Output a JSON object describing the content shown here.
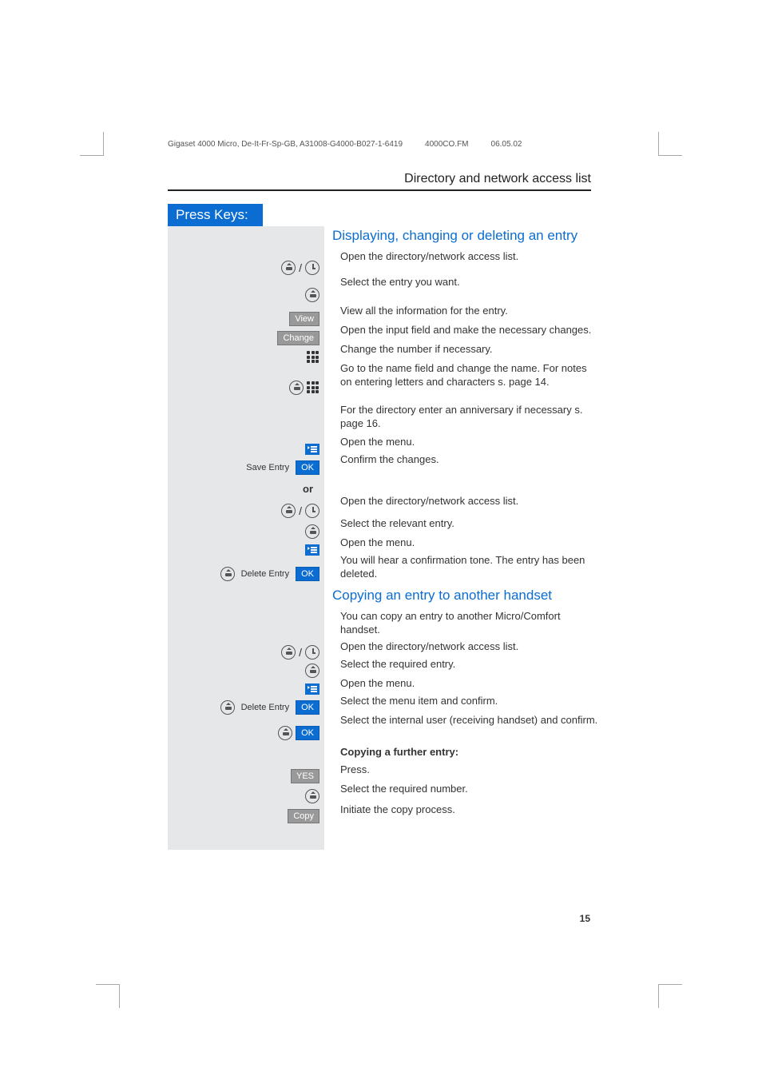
{
  "header": {
    "doc_title": "Gigaset 4000 Micro, De-It-Fr-Sp-GB, A31008-G4000-B027-1-6419",
    "file": "4000CO.FM",
    "date": "06.05.02",
    "section": "Directory and network access list"
  },
  "press_keys_label": "Press Keys:",
  "sections": {
    "s1": {
      "title": "Displaying, changing or deleting an entry",
      "r_open_dir": "Open the directory/network access list.",
      "r_select_entry": "Select the entry you want.",
      "key_view": "View",
      "r_view": "View all the information for the entry.",
      "key_change": "Change",
      "r_change": "Open the input field and make the necessary changes.",
      "r_change_number": "Change the number if necessary.",
      "r_goto_name": "Go to the name field and change the name. For notes on entering letters and characters s. page 14.",
      "r_anniversary": "For the directory enter an anniversary if necessary s. page 16.",
      "r_open_menu": "Open the menu.",
      "menu_save_entry": "Save Entry",
      "key_ok": "OK",
      "r_confirm": "Confirm the changes.",
      "or_label": "or",
      "r_open_dir2": "Open the directory/network access list.",
      "r_select_rel": "Select the relevant entry.",
      "r_open_menu2": "Open the menu.",
      "menu_delete_entry": "Delete Entry",
      "r_delete_confirm": "You will hear a confirmation tone. The entry has been deleted."
    },
    "s2": {
      "title": "Copying an entry to another handset",
      "intro": "You can copy an entry to another Micro/Comfort handset.",
      "r_open_dir": "Open the directory/network access list.",
      "r_select_req": "Select the required entry.",
      "r_open_menu": "Open the menu.",
      "menu_delete_entry": "Delete Entry",
      "key_ok": "OK",
      "r_select_menu_item": "Select the menu item and confirm.",
      "r_select_internal": "Select the internal user (receiving handset) and confirm.",
      "copy_further_label": "Copying a further entry:",
      "key_yes": "YES",
      "r_press": "Press.",
      "r_select_num": "Select the required number.",
      "key_copy": "Copy",
      "r_initiate": "Initiate the copy process."
    }
  },
  "page_number": "15"
}
